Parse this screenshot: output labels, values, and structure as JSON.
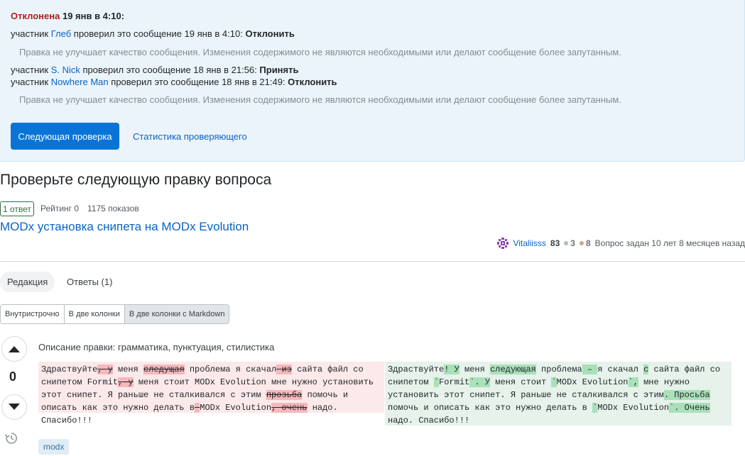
{
  "review": {
    "status_rejected": "Отклонена",
    "status_time": "19 янв в 4:10:",
    "lines": [
      {
        "prefix": "участник",
        "user": "Глеб",
        "text": "проверил это сообщение 19 янв в 4:10:",
        "result": "Отклонить"
      },
      {
        "prefix": "участник",
        "user": "S. Nick",
        "text": "проверил это сообщение 18 янв в 21:56:",
        "result": "Принять"
      },
      {
        "prefix": "участник",
        "user": "Nowhere Man",
        "text": "проверил это сообщение 18 янв в 21:49:",
        "result": "Отклонить"
      }
    ],
    "reason_1": "Правка не улучшает качество сообщения. Изменения содержимого не являются необходимыми или делают сообщение более запутанным.",
    "reason_2": "Правка не улучшает качество сообщения. Изменения содержимого не являются необходимыми или делают сообщение более запутанным.",
    "next_button": "Следующая проверка",
    "stats_link": "Статистика проверяющего"
  },
  "page": {
    "heading": "Проверьте следующую правку вопроса",
    "answers_badge": "1 ответ",
    "rating": "Рейтинг 0",
    "views": "1175 показов",
    "question_title": "MODx установка снипета на MODx Evolution"
  },
  "user": {
    "name": "Vitaliisss",
    "reputation": "83",
    "bronze": "3",
    "silver": "8",
    "asked": "Вопрос задан 10 лет 8 месяцев назад",
    "bronze_color": "#d1a684",
    "silver_color": "#b4b8bc"
  },
  "tabs": {
    "edit": "Редакция",
    "answers": "Ответы (1)"
  },
  "view_modes": [
    "Внутристрочно",
    "В две колонки",
    "В две колонки с Markdown"
  ],
  "vote": {
    "count": "0"
  },
  "edit_summary": "Описание правки: грамматика, пунктуация, стилистика",
  "diff_left": [
    {
      "t": "Здраствуйте"
    },
    {
      "t": ", у",
      "c": "del"
    },
    {
      "t": " меня "
    },
    {
      "t": "следущая",
      "c": "del"
    },
    {
      "t": " проблема я скачал"
    },
    {
      "t": " ",
      "c": "del"
    },
    {
      "t": " "
    },
    {
      "t": "из",
      "c": "del"
    },
    {
      "t": " сайта файл со снипетом Formit"
    },
    {
      "t": ", у",
      "c": "del"
    },
    {
      "t": " меня стоит MODx Evolution мне нужно установить этот снипет. Я раньше не сталкивался с этим "
    },
    {
      "t": "прозьба",
      "c": "del"
    },
    {
      "t": " помочь и описать как это нужно делать в"
    },
    {
      "t": " ",
      "c": "del"
    },
    {
      "t": " MODx Evolution"
    },
    {
      "t": ", очень",
      "c": "del"
    },
    {
      "t": " надо. Спасибо!!!"
    }
  ],
  "diff_right": [
    {
      "t": "Здраствуйте"
    },
    {
      "t": "! У",
      "c": "ins"
    },
    {
      "t": " меня "
    },
    {
      "t": "следующая",
      "c": "ins"
    },
    {
      "t": " проблема"
    },
    {
      "t": " – ",
      "c": "ins"
    },
    {
      "t": "я скачал "
    },
    {
      "t": "с",
      "c": "ins"
    },
    {
      "t": " сайта файл со снипетом "
    },
    {
      "t": "`",
      "c": "ins"
    },
    {
      "t": "Formit"
    },
    {
      "t": "`. У",
      "c": "ins"
    },
    {
      "t": " меня стоит "
    },
    {
      "t": "`",
      "c": "ins"
    },
    {
      "t": "MODx Evolution"
    },
    {
      "t": "`,",
      "c": "ins"
    },
    {
      "t": " мне нужно установить этот снипет. Я раньше не сталкивался с этим"
    },
    {
      "t": ". Просьба",
      "c": "ins"
    },
    {
      "t": " помочь и описать как это нужно делать в "
    },
    {
      "t": "`",
      "c": "ins"
    },
    {
      "t": "MODx Evolution"
    },
    {
      "t": "`. Очень",
      "c": "ins"
    },
    {
      "t": " надо. Спасибо!!!"
    }
  ],
  "tag": "modx"
}
